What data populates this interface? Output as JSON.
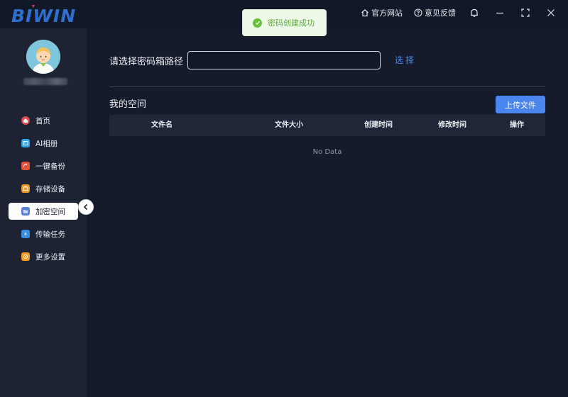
{
  "app": {
    "logo_text": "BIWIN",
    "official_site": "官方网站",
    "feedback": "意见反馈"
  },
  "sidebar": {
    "items": [
      {
        "label": "首页",
        "icon": "home-icon",
        "color": "#d9534f"
      },
      {
        "label": "AI相册",
        "icon": "photo-icon",
        "color": "#2fa4e7"
      },
      {
        "label": "一键备份",
        "icon": "backup-icon",
        "color": "#e2533b"
      },
      {
        "label": "存储设备",
        "icon": "storage-icon",
        "color": "#e7962a"
      },
      {
        "label": "加密空间",
        "icon": "folder-lock-icon",
        "color": "#5b7fd6"
      },
      {
        "label": "传输任务",
        "icon": "transfer-icon",
        "color": "#3b8de0"
      },
      {
        "label": "更多设置",
        "icon": "settings-icon",
        "color": "#f19a24"
      }
    ],
    "active_index": 4
  },
  "vault": {
    "path_label": "请选择密码箱路径",
    "path_value": "",
    "select_label": "选择"
  },
  "files": {
    "title": "我的空间",
    "upload_label": "上传文件",
    "columns": [
      "文件名",
      "文件大小",
      "创建时间",
      "修改时间",
      "操作"
    ],
    "empty_text": "No Data"
  },
  "toast": {
    "message": "密码创建成功",
    "type": "success"
  },
  "colors": {
    "accent": "#4a86ee",
    "success": "#67c23a"
  }
}
